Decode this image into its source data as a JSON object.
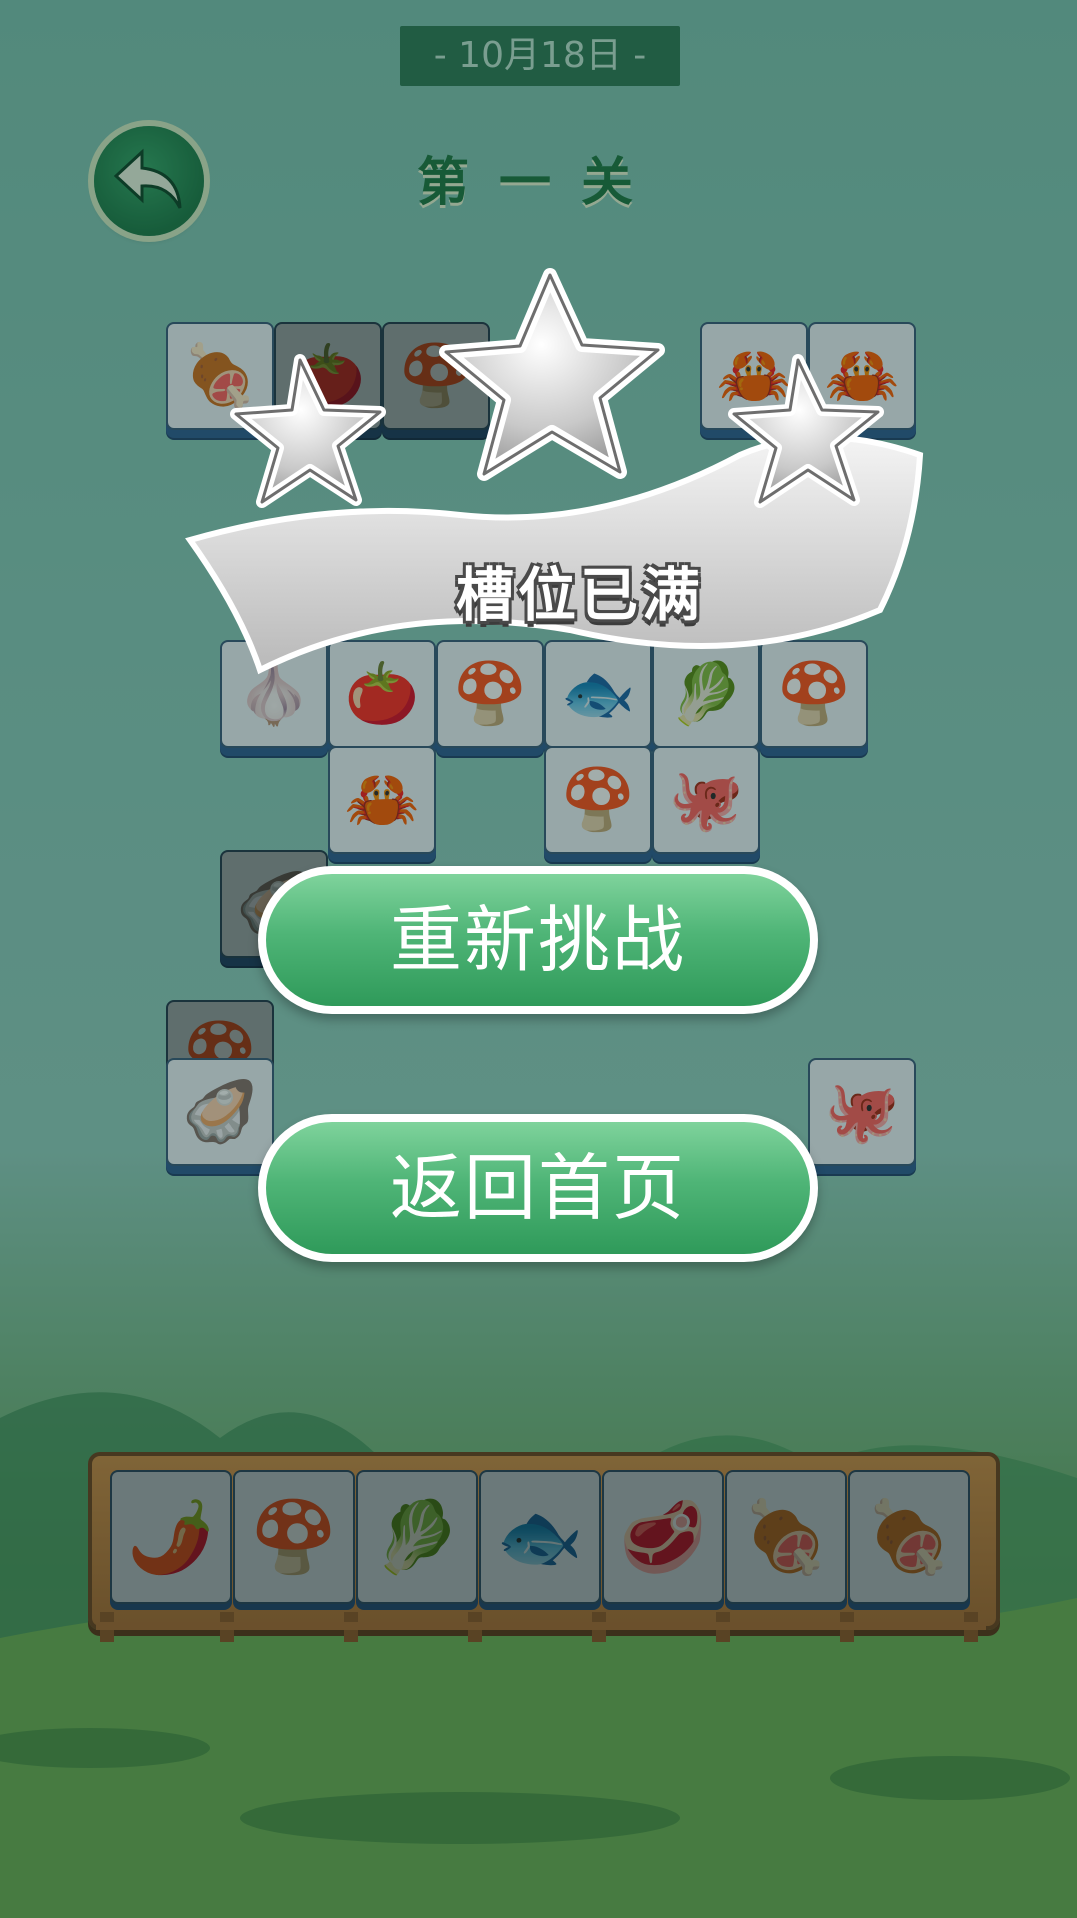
{
  "header": {
    "date": "- 10月18日 -",
    "level_title": "第一关"
  },
  "board_tiles": [
    {
      "icon": "🍖",
      "name": "meat"
    },
    {
      "icon": "🍅",
      "name": "tomato"
    },
    {
      "icon": "🍄",
      "name": "mushroom"
    },
    {
      "icon": "🦀",
      "name": "crab"
    },
    {
      "icon": "🦀",
      "name": "crab"
    },
    {
      "icon": "🧄",
      "name": "garlic"
    },
    {
      "icon": "🍅",
      "name": "tomato"
    },
    {
      "icon": "🍄",
      "name": "mushroom"
    },
    {
      "icon": "🐟",
      "name": "fish-cracker"
    },
    {
      "icon": "🥬",
      "name": "cabbage"
    },
    {
      "icon": "🍄",
      "name": "mushroom"
    },
    {
      "icon": "🦀",
      "name": "crab"
    },
    {
      "icon": "🍄",
      "name": "mushroom"
    },
    {
      "icon": "🐙",
      "name": "octopus"
    },
    {
      "icon": "🦪",
      "name": "clam"
    },
    {
      "icon": "🍄",
      "name": "mushroom"
    },
    {
      "icon": "🦪",
      "name": "clam"
    },
    {
      "icon": "🐙",
      "name": "octopus"
    }
  ],
  "popup": {
    "stars": 0,
    "banner_text": "槽位已满",
    "retry_label": "重新挑战",
    "home_label": "返回首页"
  },
  "slot_tray": {
    "items": [
      {
        "icon": "🌶️",
        "name": "chili"
      },
      {
        "icon": "🍄",
        "name": "mushroom"
      },
      {
        "icon": "🥬",
        "name": "cabbage"
      },
      {
        "icon": "🐟",
        "name": "fish"
      },
      {
        "icon": "🥩",
        "name": "steak"
      },
      {
        "icon": "🍖",
        "name": "meat"
      },
      {
        "icon": "🍖",
        "name": "meat"
      }
    ]
  },
  "colors": {
    "accent_green": "#2f9a5a",
    "title_green": "#1f7a45",
    "tile_blue": "#2f5f94"
  }
}
